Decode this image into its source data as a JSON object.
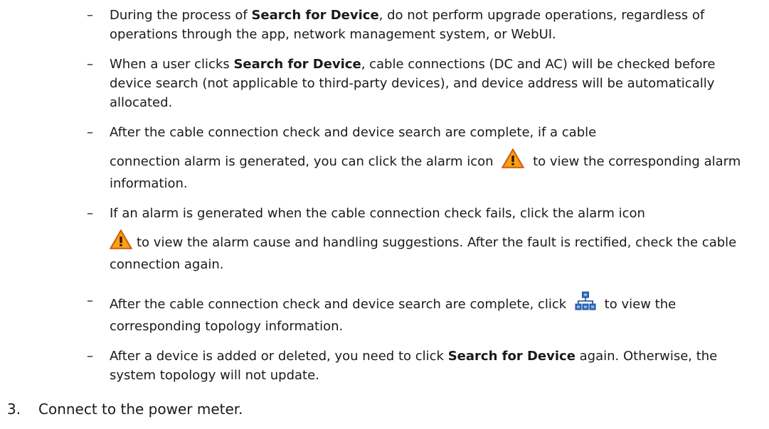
{
  "bullets": [
    {
      "dash": "–",
      "pre": "During the process of ",
      "bold": "Search for Device",
      "post": ", do not perform upgrade operations, regardless of operations through the app, network management system, or WebUI."
    },
    {
      "dash": "–",
      "pre": "When a user clicks ",
      "bold": "Search for Device",
      "post": ", cable connections (DC and AC) will be checked before device search (not applicable to third-party devices), and device address will be automatically allocated."
    },
    {
      "dash": "–",
      "line1": "After the cable connection check and device search are complete, if a cable",
      "pre": "connection alarm is generated, you can click the alarm icon",
      "icon": "warning-triangle-icon",
      "post": "to view the corresponding alarm information."
    },
    {
      "dash": "–",
      "line1": "If an alarm is generated when the cable connection check fails, click the alarm icon",
      "icon": "warning-triangle-icon",
      "post": "to view the alarm cause and handling suggestions. After the fault is rectified, check the cable connection again."
    },
    {
      "dash": "–",
      "pre": "After the cable connection check and device search are complete, click",
      "icon": "topology-icon",
      "post": "to view the corresponding topology information."
    },
    {
      "dash": "–",
      "pre": "After a device is added or deleted, you need to click ",
      "bold": "Search for Device",
      "post": " again. Otherwise, the system topology will not update."
    }
  ],
  "step": {
    "number": "3.",
    "text": "Connect to the power meter."
  },
  "colors": {
    "warning_fill": "#f28c00",
    "topology_fill": "#2f6fbf"
  }
}
